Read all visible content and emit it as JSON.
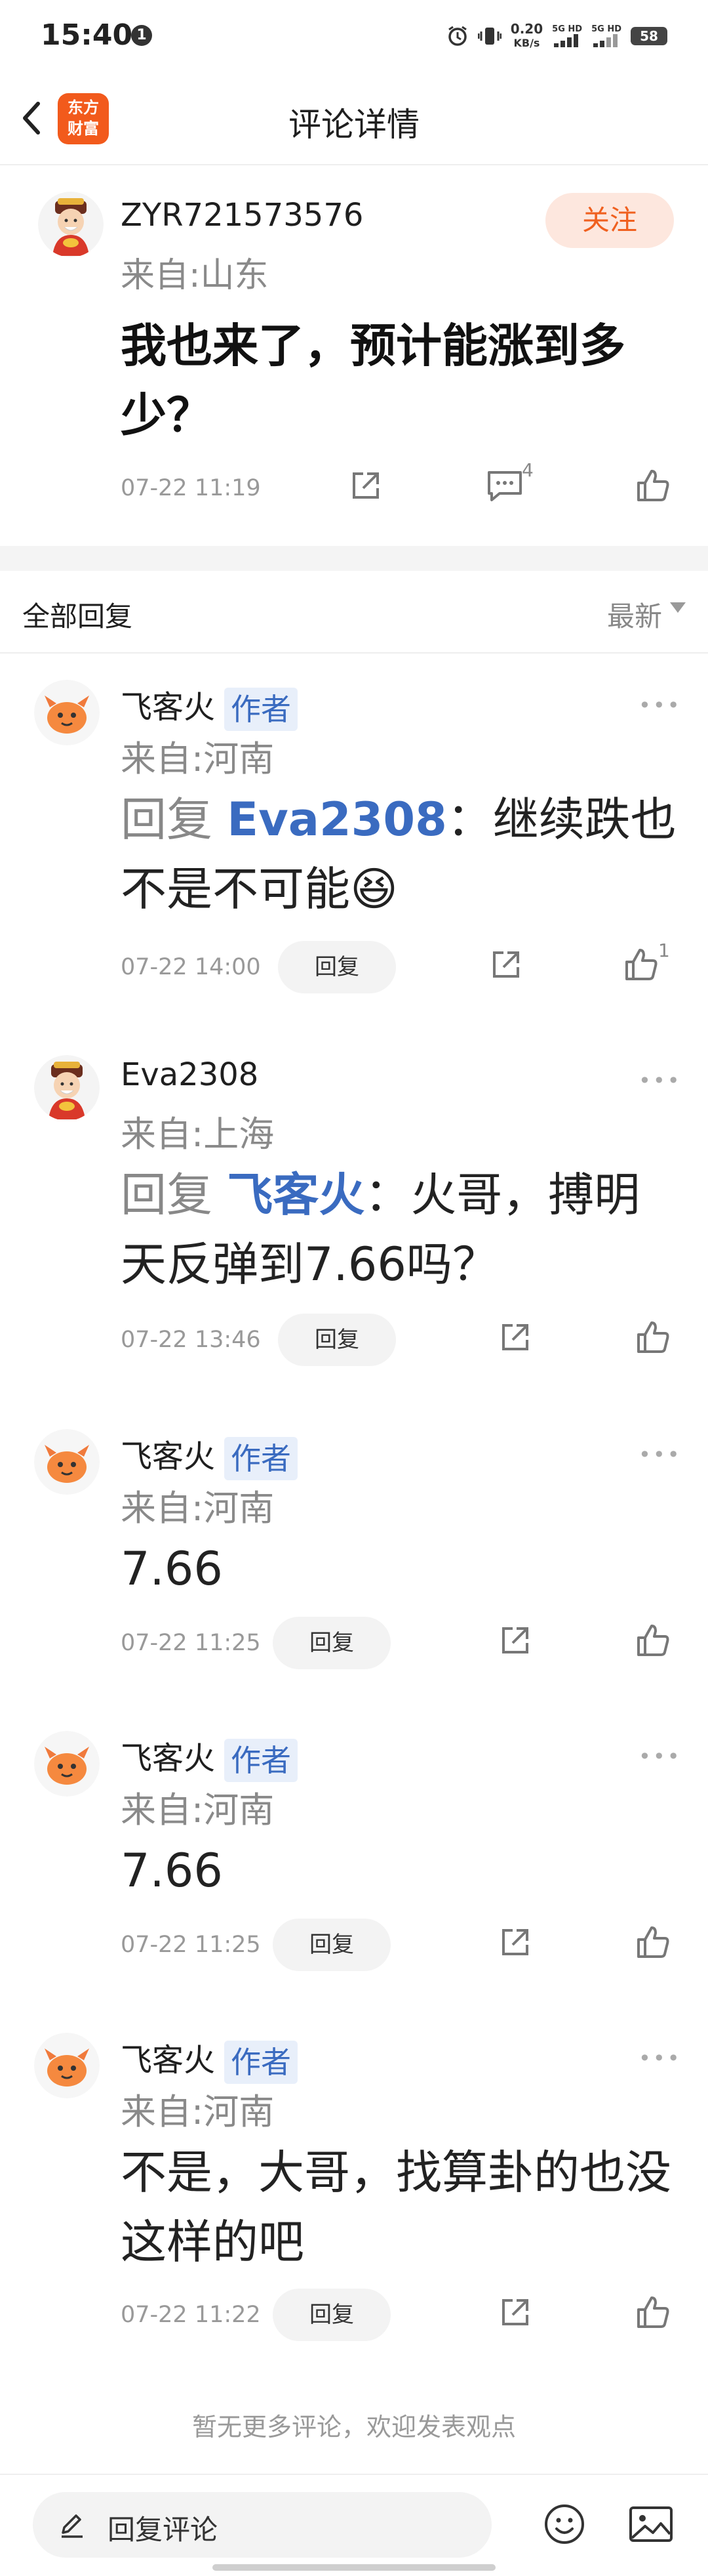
{
  "status_bar": {
    "time": "15:40",
    "notification_count": "1",
    "net_speed_value": "0.20",
    "net_speed_unit": "KB/s",
    "signal_1": "5G HD",
    "signal_2": "5G HD",
    "battery": "58"
  },
  "nav": {
    "title": "评论详情",
    "logo_line1": "东方",
    "logo_line2": "财富"
  },
  "post": {
    "username": "ZYR721573576",
    "location": "来自:山东",
    "follow_label": "关注",
    "text": "我也来了，预计能涨到多少？",
    "time": "07-22 11:19",
    "comment_count": "4"
  },
  "replies_header": {
    "title": "全部回复",
    "sort_label": "最新"
  },
  "replies": [
    {
      "username": "飞客火",
      "badge": "作者",
      "location": "来自:河南",
      "prefix": "回复 ",
      "target": "Eva2308",
      "text": "：继续跌也不是不可能😆",
      "time": "07-22 14:00",
      "reply_label": "回复",
      "like_count": "1",
      "more": "•••"
    },
    {
      "username": "Eva2308",
      "location": "来自:上海",
      "prefix": "回复 ",
      "target": "飞客火",
      "text": "：火哥，搏明天反弹到7.66吗？",
      "time": "07-22 13:46",
      "reply_label": "回复",
      "more": "•••"
    },
    {
      "username": "飞客火",
      "badge": "作者",
      "location": "来自:河南",
      "text": "7.66",
      "time": "07-22 11:25",
      "reply_label": "回复",
      "more": "•••"
    },
    {
      "username": "飞客火",
      "badge": "作者",
      "location": "来自:河南",
      "text": "7.66",
      "time": "07-22 11:25",
      "reply_label": "回复",
      "more": "•••"
    },
    {
      "username": "飞客火",
      "badge": "作者",
      "location": "来自:河南",
      "text": "不是，大哥，找算卦的也没这样的吧",
      "time": "07-22 11:22",
      "reply_label": "回复",
      "more": "•••"
    }
  ],
  "no_more_text": "暂无更多评论，欢迎发表观点",
  "bottom_bar": {
    "reply_placeholder": "回复评论"
  },
  "icons": {
    "back": "chevron-left-icon",
    "share": "share-icon",
    "comment": "comment-icon",
    "like": "thumbs-up-icon",
    "edit": "pencil-icon",
    "emoji": "smiley-icon",
    "image": "image-icon",
    "more": "more-dots-icon"
  },
  "colors": {
    "accent": "#f0601f",
    "follow_bg": "#fde7de",
    "link_blue": "#3a6bc0",
    "badge_bg": "#e8effa",
    "muted": "#8a8a8a"
  }
}
